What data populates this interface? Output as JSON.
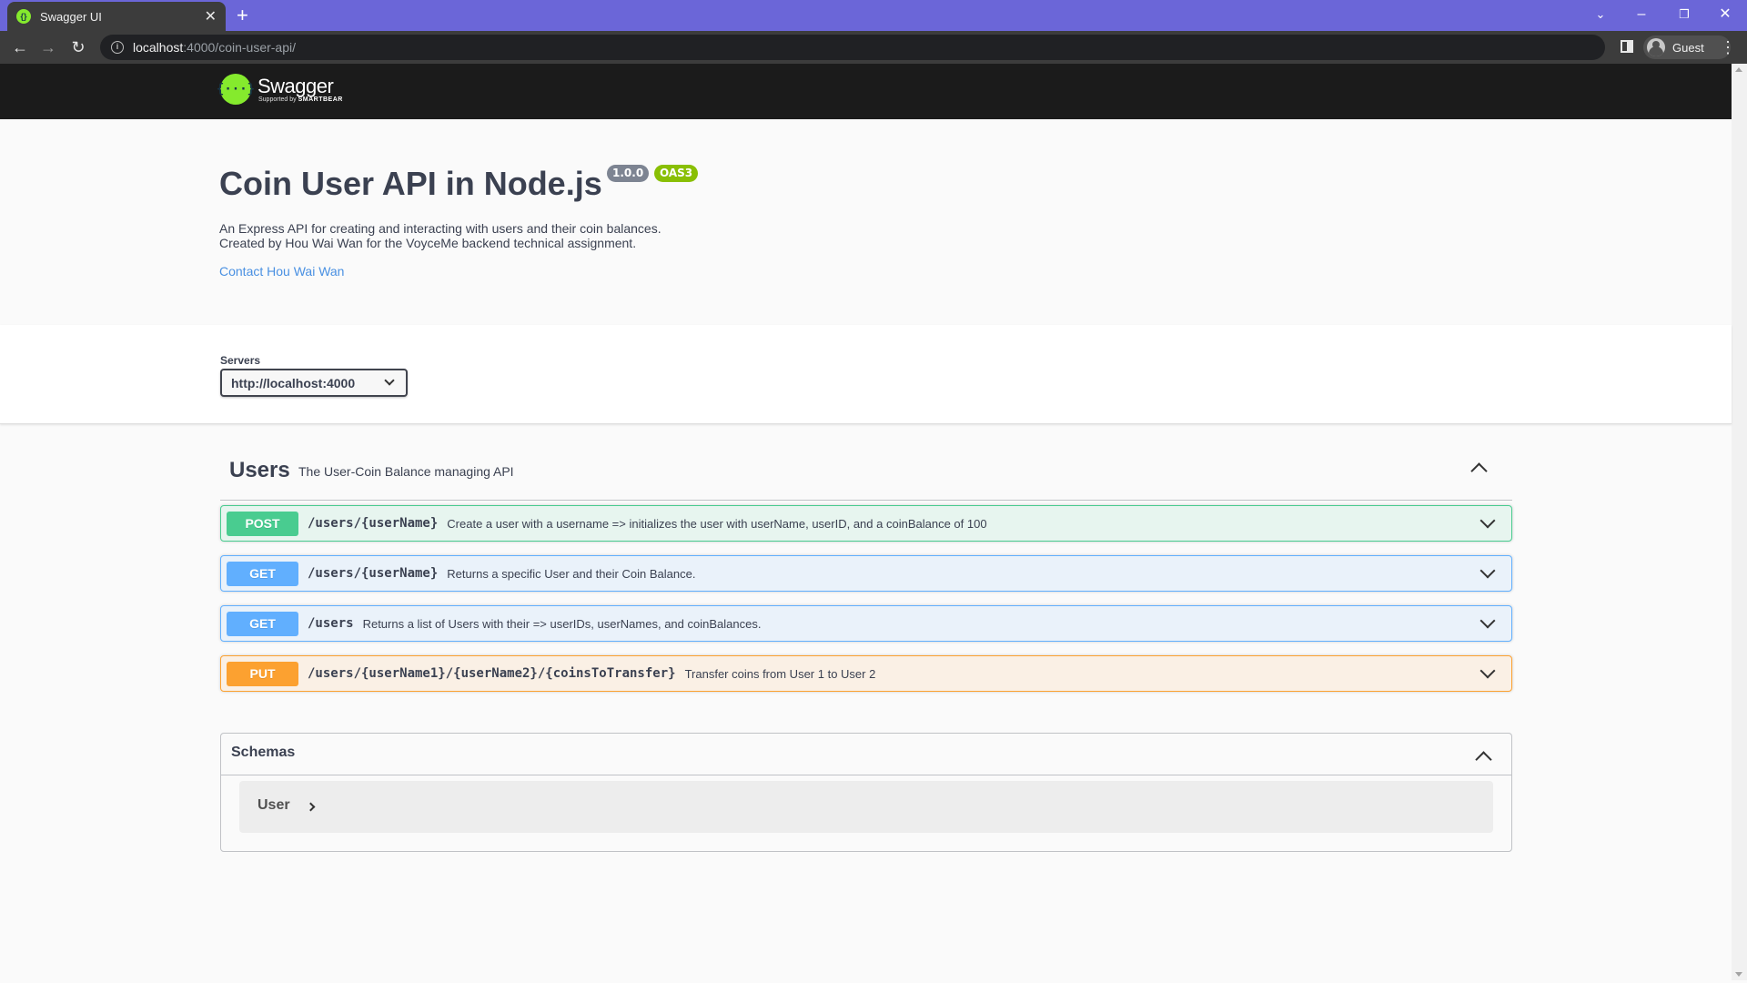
{
  "browser": {
    "tab_title": "Swagger UI",
    "url_host": "localhost",
    "url_path": ":4000/coin-user-api/",
    "profile_label": "Guest"
  },
  "swagger_header": {
    "logo_text": "Swagger",
    "logo_subtext_prefix": "Supported by",
    "logo_subtext_brand": "SMARTBEAR"
  },
  "info": {
    "title": "Coin User API in Node.js",
    "version": "1.0.0",
    "oas": "OAS3",
    "description_line1": "An Express API for creating and interacting with users and their coin balances.",
    "description_line2": "Created by Hou Wai Wan for the VoyceMe backend technical assignment.",
    "contact": "Contact Hou Wai Wan"
  },
  "servers": {
    "label": "Servers",
    "selected": "http://localhost:4000"
  },
  "tag": {
    "name": "Users",
    "description": "The User-Coin Balance managing API"
  },
  "operations": [
    {
      "method": "POST",
      "path": "/users/{userName}",
      "summary": "Create a user with a username => initializes the user with userName, userID, and a coinBalance of 100"
    },
    {
      "method": "GET",
      "path": "/users/{userName}",
      "summary": "Returns a specific User and their Coin Balance."
    },
    {
      "method": "GET",
      "path": "/users",
      "summary": "Returns a list of Users with their => userIDs, userNames, and coinBalances."
    },
    {
      "method": "PUT",
      "path": "/users/{userName1}/{userName2}/{coinsToTransfer}",
      "summary": "Transfer coins from User 1 to User 2"
    }
  ],
  "schemas": {
    "title": "Schemas",
    "models": [
      "User"
    ]
  },
  "colors": {
    "titlebar": "#6b66d8",
    "post": "#49cc90",
    "get": "#61affe",
    "put": "#fca130",
    "swagger_green": "#85ea2d"
  }
}
